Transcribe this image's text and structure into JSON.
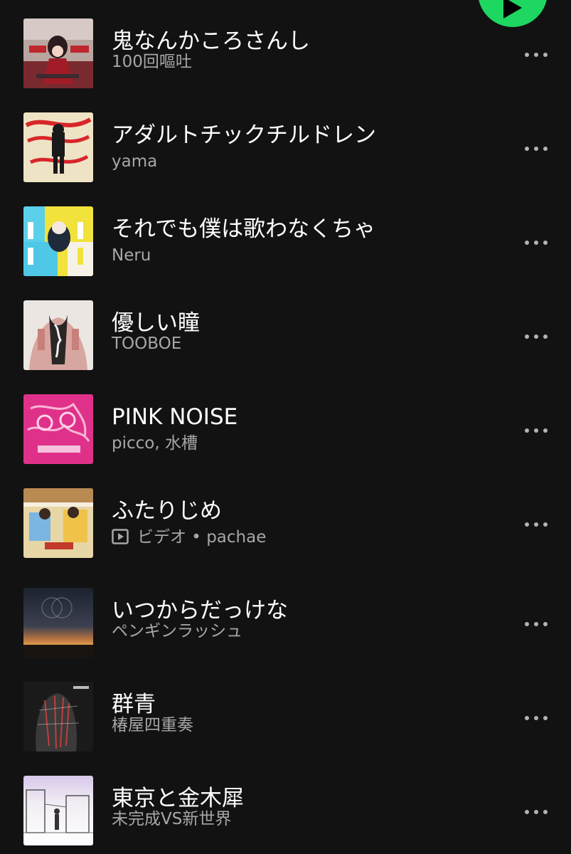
{
  "tracks": [
    {
      "title": "鬼なんかころさんし",
      "subtitle": "100回嘔吐",
      "is_video": false,
      "more_icon": "ellipsis-icon"
    },
    {
      "title": "アダルトチックチルドレン",
      "subtitle": "yama",
      "is_video": false,
      "more_icon": "ellipsis-icon"
    },
    {
      "title": "それでも僕は歌わなくちゃ",
      "subtitle": "Neru",
      "is_video": false,
      "more_icon": "ellipsis-icon"
    },
    {
      "title": "優しい瞳",
      "subtitle": "TOOBOE",
      "is_video": false,
      "more_icon": "ellipsis-icon"
    },
    {
      "title": "PINK NOISE",
      "subtitle": "picco, 水槽",
      "is_video": false,
      "more_icon": "ellipsis-icon"
    },
    {
      "title": "ふたりじめ",
      "subtitle": "ビデオ • pachae",
      "is_video": true,
      "more_icon": "ellipsis-icon"
    },
    {
      "title": "いつからだっけな",
      "subtitle": "ペンギンラッシュ",
      "is_video": false,
      "more_icon": "ellipsis-icon"
    },
    {
      "title": "群青",
      "subtitle": "椿屋四重奏",
      "is_video": false,
      "more_icon": "ellipsis-icon"
    },
    {
      "title": "東京と金木犀",
      "subtitle": "未完成VS新世界",
      "is_video": false,
      "more_icon": "ellipsis-icon"
    }
  ],
  "colors": {
    "background": "#121212",
    "accent": "#1ed760",
    "title": "#ffffff",
    "subtitle": "#a7a7a7"
  },
  "play_button_icon": "play-icon"
}
